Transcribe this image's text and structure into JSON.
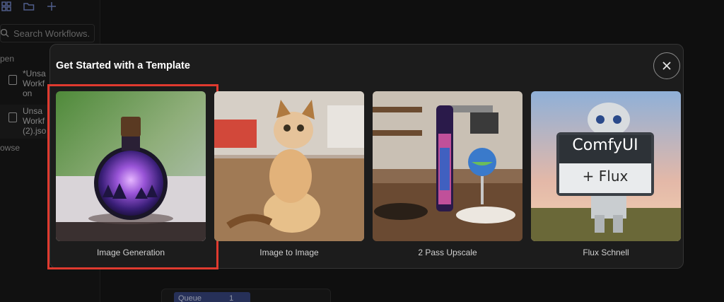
{
  "sidebar": {
    "search_placeholder": "Search Workflows.",
    "section_open": "pen",
    "files": [
      {
        "label_lines": [
          "*Unsa",
          "Workf",
          "on"
        ]
      },
      {
        "label_lines": [
          "Unsa",
          "Workf",
          "(2).jso"
        ]
      }
    ],
    "section_browse": "owse"
  },
  "queue": {
    "label": "Queue",
    "count": "1"
  },
  "dialog": {
    "title": "Get Started with a Template",
    "close_icon": "close-icon",
    "templates": [
      {
        "label": "Image Generation",
        "selected": true
      },
      {
        "label": "Image to Image",
        "selected": false
      },
      {
        "label": "2 Pass Upscale",
        "selected": false
      },
      {
        "label": "Flux Schnell",
        "selected": false
      }
    ],
    "flux_sign": {
      "line1": "ComfyUI",
      "line2": "+ Flux"
    }
  },
  "colors": {
    "selection_outline": "#e03a2f",
    "accent": "#7a8fd6"
  }
}
